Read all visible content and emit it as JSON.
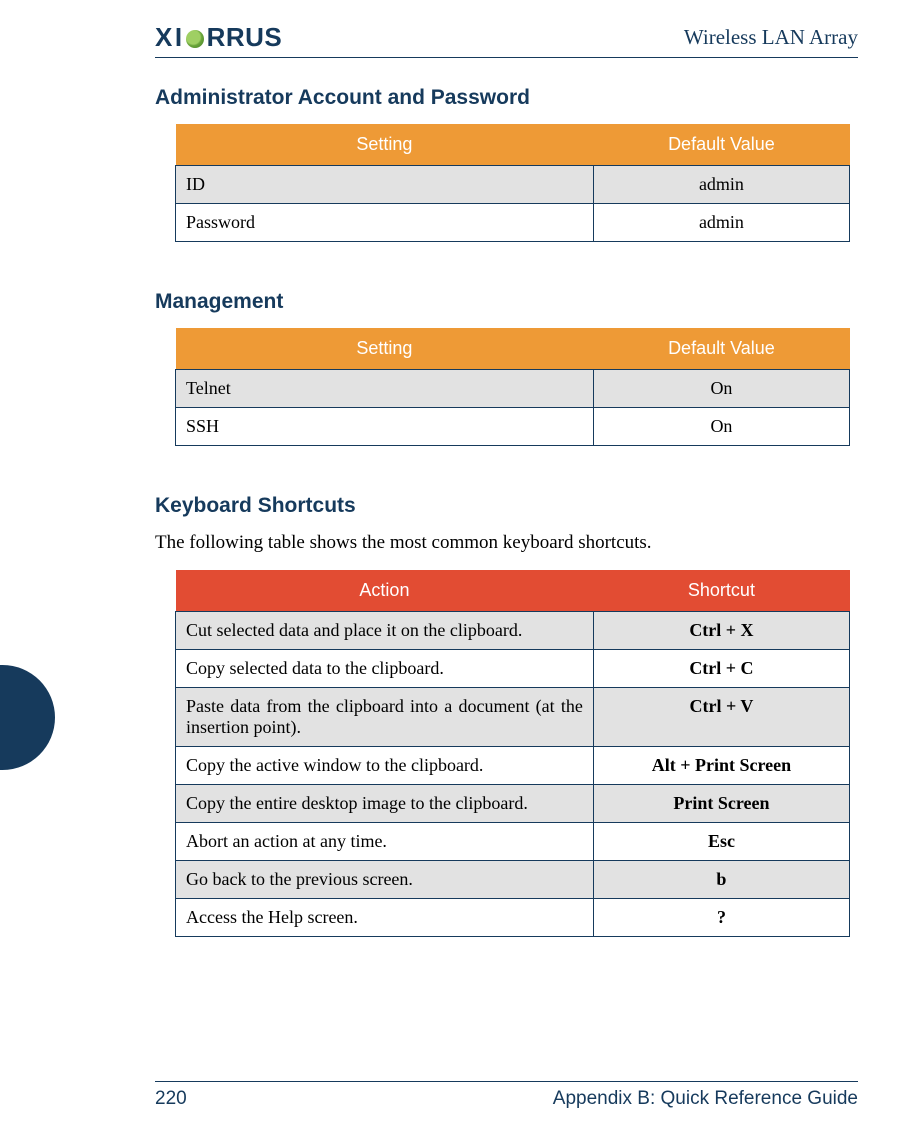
{
  "header": {
    "logo_text_prefix": "X",
    "logo_text_mid": "RRUS",
    "logo_i_glyph": "I",
    "product_name": "Wireless LAN Array"
  },
  "sections": {
    "admin": {
      "heading": "Administrator Account and Password",
      "columns": {
        "setting": "Setting",
        "value": "Default Value"
      },
      "rows": [
        {
          "setting": "ID",
          "value": "admin"
        },
        {
          "setting": "Password",
          "value": "admin"
        }
      ]
    },
    "management": {
      "heading": "Management",
      "columns": {
        "setting": "Setting",
        "value": "Default Value"
      },
      "rows": [
        {
          "setting": "Telnet",
          "value": "On"
        },
        {
          "setting": "SSH",
          "value": "On"
        }
      ]
    },
    "shortcuts": {
      "heading": "Keyboard Shortcuts",
      "intro": "The following table shows the most common keyboard shortcuts.",
      "columns": {
        "action": "Action",
        "shortcut": "Shortcut"
      },
      "rows": [
        {
          "action": "Cut selected data and place it on the clipboard.",
          "shortcut": "Ctrl + X"
        },
        {
          "action": "Copy selected data to the clipboard.",
          "shortcut": "Ctrl + C"
        },
        {
          "action": "Paste data from the clipboard into a document (at the insertion point).",
          "shortcut": "Ctrl + V"
        },
        {
          "action": "Copy the active window to the clipboard.",
          "shortcut": "Alt + Print Screen"
        },
        {
          "action": "Copy the entire desktop image to the clipboard.",
          "shortcut": "Print Screen"
        },
        {
          "action": "Abort an action at any time.",
          "shortcut": "Esc"
        },
        {
          "action": "Go back to the previous screen.",
          "shortcut": "b"
        },
        {
          "action": "Access the Help screen.",
          "shortcut": "?"
        }
      ]
    }
  },
  "footer": {
    "page_number": "220",
    "appendix": "Appendix B: Quick Reference Guide"
  }
}
